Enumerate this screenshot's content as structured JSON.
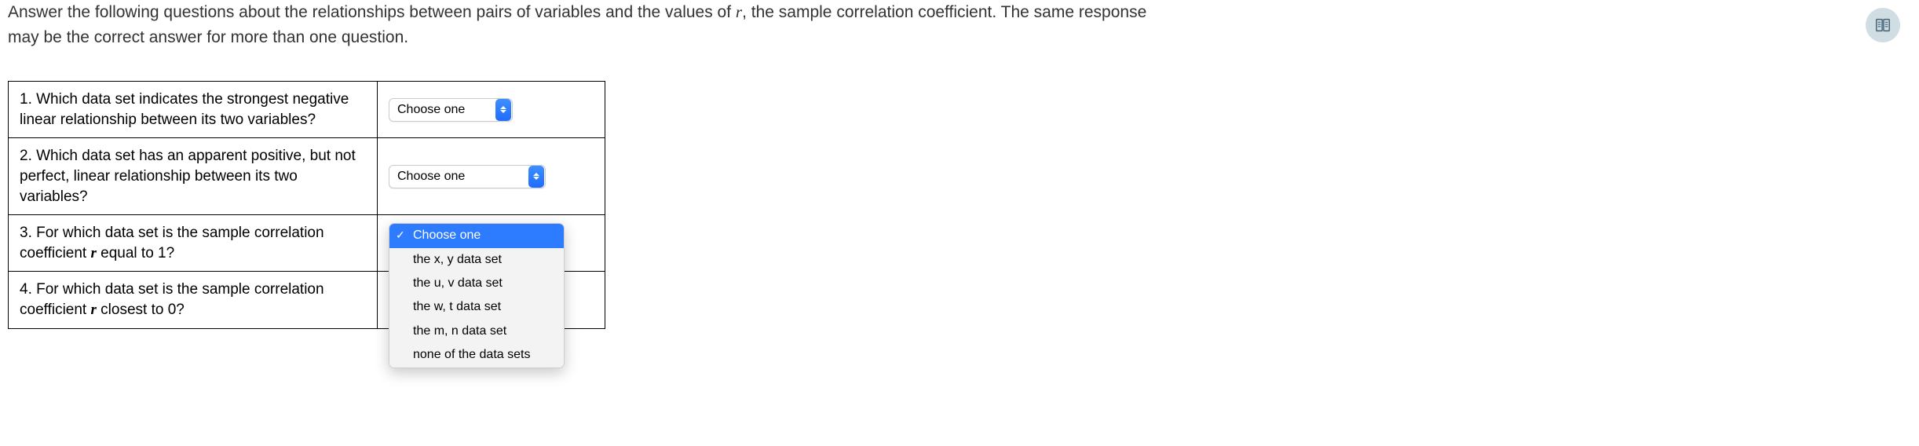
{
  "instructions": {
    "line1_prefix": "Answer the following questions about the relationships between pairs of variables and the values of ",
    "r_symbol": "r",
    "line1_suffix": ", the sample correlation coefficient. The same response",
    "line2": "may be the correct answer for more than one question."
  },
  "questions": {
    "q1": "1. Which data set indicates the strongest negative linear relationship between its two variables?",
    "q2": "2. Which data set has an apparent positive, but not perfect, linear relationship between its two variables?",
    "q3_prefix": "3. For which data set is the sample correlation coefficient ",
    "q3_r": "r",
    "q3_suffix": " equal to 1?",
    "q4_prefix": "4. For which data set is the sample correlation coefficient ",
    "q4_r": "r",
    "q4_suffix": " closest to 0?"
  },
  "select": {
    "placeholder": "Choose one"
  },
  "dropdown": {
    "opt0": "Choose one",
    "opt1": "the x, y data set",
    "opt2": "the u, v data set",
    "opt3": "the w, t data set",
    "opt4": "the m, n data set",
    "opt5": "none of the data sets"
  }
}
